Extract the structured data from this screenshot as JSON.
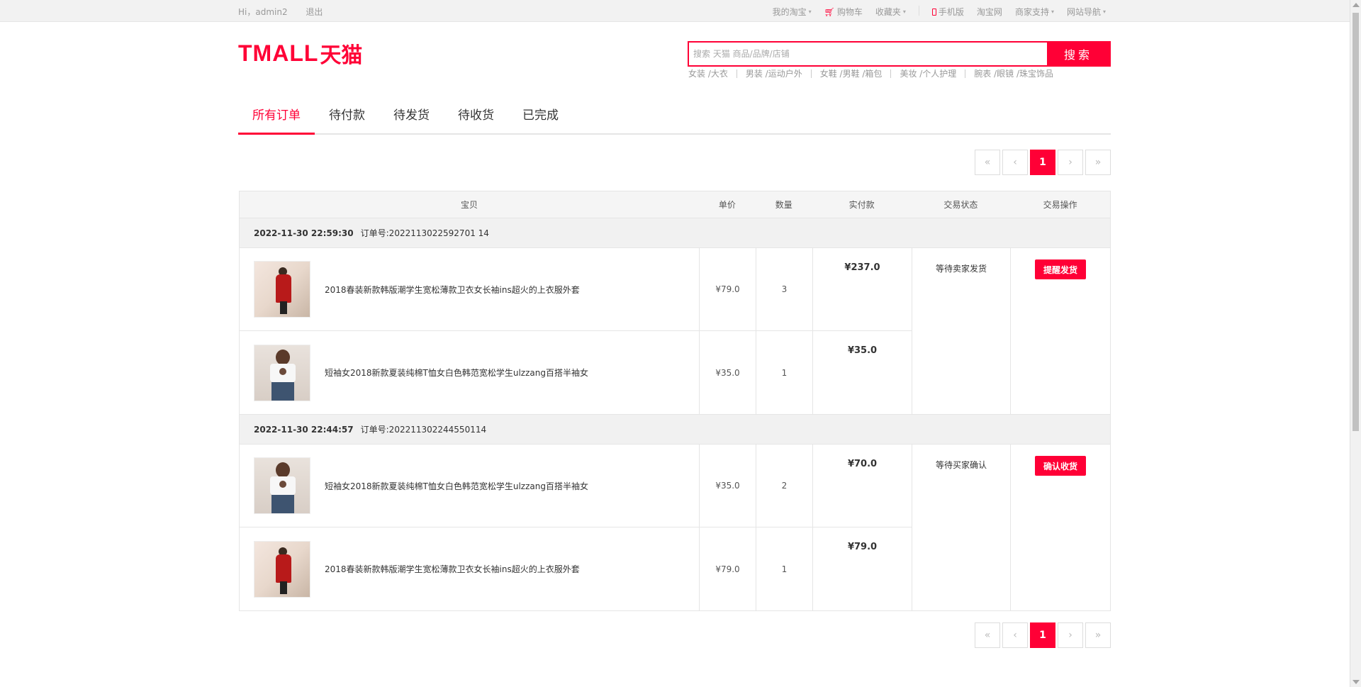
{
  "topbar": {
    "greeting": "Hi，admin2",
    "logout": "退出",
    "links": {
      "my_taobao": "我的淘宝",
      "cart": "购物车",
      "favorites": "收藏夹",
      "mobile": "手机版",
      "taobao": "淘宝网",
      "merchant": "商家支持",
      "sitenav": "网站导航"
    }
  },
  "logo": {
    "latin": "TMALL",
    "cn": "天猫"
  },
  "search": {
    "placeholder": "搜索 天猫 商品/品牌/店铺",
    "button": "搜索",
    "hotwords": [
      "女装 /大衣",
      "男装 /运动户外",
      "女鞋 /男鞋 /箱包",
      "美妆 /个人护理",
      "腕表 /眼镜 /珠宝饰品"
    ]
  },
  "tabs": [
    "所有订单",
    "待付款",
    "待发货",
    "待收货",
    "已完成"
  ],
  "pager": {
    "first": "«",
    "prev": "‹",
    "current": "1",
    "next": "›",
    "last": "»"
  },
  "table": {
    "headers": [
      "宝贝",
      "单价",
      "数量",
      "实付款",
      "交易状态",
      "交易操作"
    ],
    "orders": [
      {
        "time": "2022-11-30 22:59:30",
        "order_no": "订单号:2022113022592701 14",
        "status": "等待卖家发货",
        "action": "提醒发货",
        "items": [
          {
            "name": "2018春装新款韩版潮学生宽松薄款卫衣女长袖ins超火的上衣服外套",
            "price": "¥79.0",
            "qty": "3",
            "pay": "¥237.0"
          },
          {
            "name": "短袖女2018新款夏装纯棉T恤女白色韩范宽松学生ulzzang百搭半袖女",
            "price": "¥35.0",
            "qty": "1",
            "pay": "¥35.0"
          }
        ]
      },
      {
        "time": "2022-11-30 22:44:57",
        "order_no": "订单号:202211302244550114",
        "status": "等待买家确认",
        "action": "确认收货",
        "items": [
          {
            "name": "短袖女2018新款夏装纯棉T恤女白色韩范宽松学生ulzzang百搭半袖女",
            "price": "¥35.0",
            "qty": "2",
            "pay": "¥70.0"
          },
          {
            "name": "2018春装新款韩版潮学生宽松薄款卫衣女长袖ins超火的上衣服外套",
            "price": "¥79.0",
            "qty": "1",
            "pay": "¥79.0"
          }
        ]
      }
    ]
  },
  "colors": {
    "brand": "#ff0036",
    "topbar_bg": "#f2f2f2",
    "header_bg": "#f5f5f5"
  }
}
